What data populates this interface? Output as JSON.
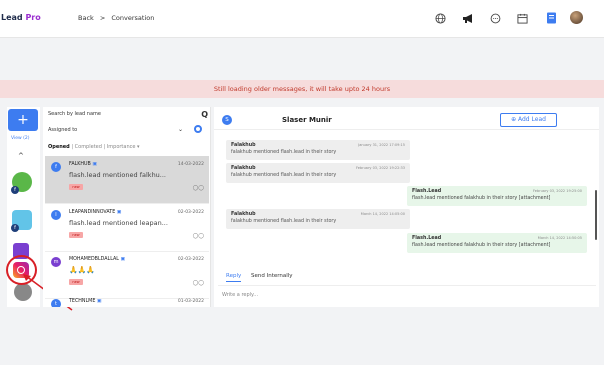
{
  "app": {
    "brand_main": "Lead ",
    "brand_pro": "Pro"
  },
  "breadcrumb": {
    "back": "Back",
    "sep": ">",
    "current": "Conversation"
  },
  "topbar_icons": [
    "globe-icon",
    "megaphone-icon",
    "chat-icon",
    "calendar-icon",
    "document-icon",
    "avatar"
  ],
  "notice": "Still loading older messages, it will take upto 24 hours",
  "sidebar": {
    "add_label": "+",
    "view_all": "View (2)",
    "caret": "^"
  },
  "list": {
    "search_placeholder": "Search by lead name",
    "search_icon": "Q",
    "assigned_label": "Assigned to",
    "assigned_chevron": "⌄",
    "tabs": {
      "opened": "Opened",
      "sep1": "|",
      "completed": "Completed",
      "sep2": "|",
      "importance": "Importance ▾"
    },
    "items": [
      {
        "initial": "f",
        "name": "FALKHUB",
        "date": "14-03-2022",
        "message": "flash.lead mentioned falkhu...",
        "tag": "new",
        "actions": "◯◯"
      },
      {
        "initial": "l",
        "name": "LEAPANDINNOVATE",
        "date": "02-03-2022",
        "message": "flash.lead mentioned leapan...",
        "tag": "new",
        "actions": "◯◯"
      },
      {
        "initial": "m",
        "name": "MOHAMEDBLDALLAL",
        "date": "02-03-2022",
        "message": "🙏🙏🙏",
        "tag": "new",
        "actions": "◯◯"
      },
      {
        "initial": "t",
        "name": "TECHNLME",
        "date": "01-03-2022",
        "message": "",
        "tag": "",
        "actions": ""
      }
    ]
  },
  "chat": {
    "avatar_initial": "S",
    "contact_name": "Slaser Munir",
    "add_lead": "⊕ Add Lead",
    "messages": [
      {
        "dir": "in",
        "name": "Falakhub",
        "time": "January 31, 2022 17:09:15",
        "body": "falakhub mentioned flash.lead in their story"
      },
      {
        "dir": "in",
        "name": "Falakhub",
        "time": "February 03, 2022 19:22:33",
        "body": "falakhub mentioned flash.lead in their story"
      },
      {
        "dir": "out",
        "name": "Flash.Lead",
        "time": "February 03, 2022 19:25:00",
        "body": "flash.lead mentioned falakhub in their story [attachment]"
      },
      {
        "dir": "in",
        "name": "Falakhub",
        "time": "March 14, 2022 14:05:00",
        "body": "falakhub mentioned flash.lead in their story"
      },
      {
        "dir": "out",
        "name": "Flash.Lead",
        "time": "March 14, 2022 14:50:05",
        "body": "flash.lead mentioned falakhub in their story [attachment]"
      }
    ],
    "reply_tab": "Reply",
    "send_internally_tab": "Send Internally",
    "reply_placeholder": "Write a reply..."
  }
}
